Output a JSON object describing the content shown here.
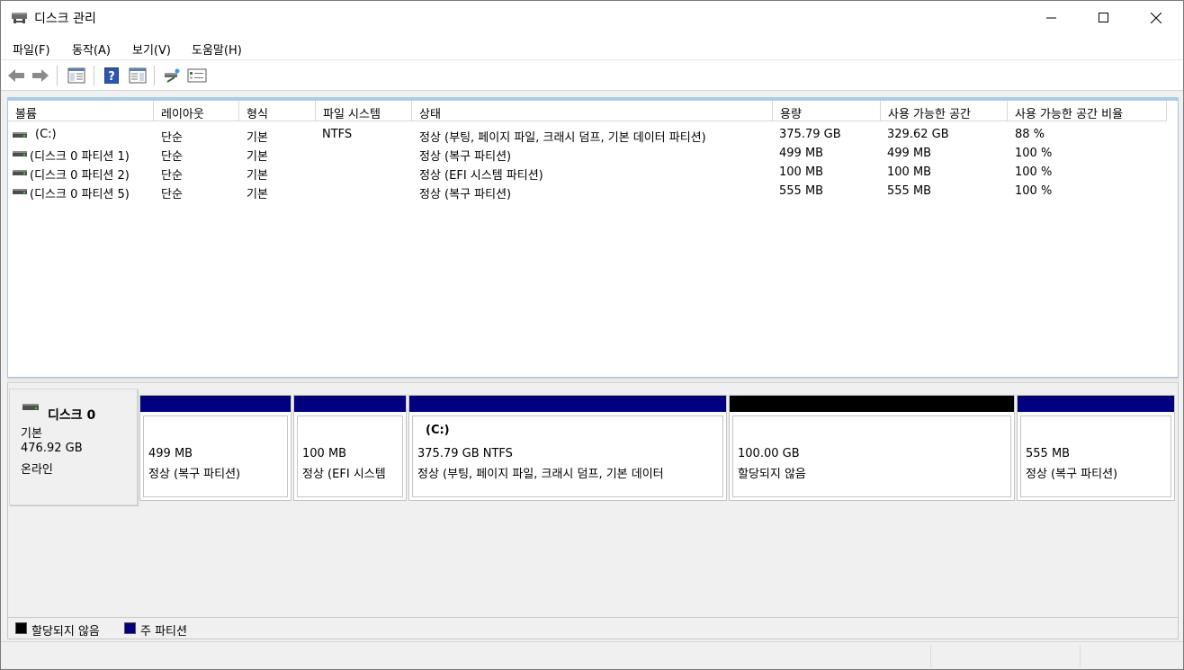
{
  "window": {
    "title": "디스크 관리",
    "controls": {
      "minimize": "minimize-icon",
      "maximize": "maximize-icon",
      "close": "close-icon"
    }
  },
  "menu": [
    "파일(F)",
    "동작(A)",
    "보기(V)",
    "도움말(H)"
  ],
  "toolbar": [
    "back-arrow-icon",
    "forward-arrow-icon",
    "show-hide-console-tree-icon",
    "help-icon",
    "show-hide-action-pane-icon",
    "connect-disk-icon",
    "properties-icon"
  ],
  "volume_list": {
    "columns": [
      "볼륨",
      "레이아웃",
      "형식",
      "파일 시스템",
      "상태",
      "용량",
      "사용 가능한 공간",
      "사용 가능한 공간 비율"
    ],
    "rows": [
      {
        "volume": "(C:)",
        "layout": "단순",
        "type": "기본",
        "fs": "NTFS",
        "status": "정상 (부팅, 페이지 파일, 크래시 덤프, 기본 데이터 파티션)",
        "capacity": "375.79 GB",
        "free": "329.62 GB",
        "pct": "88 %"
      },
      {
        "volume": "(디스크 0 파티션 1)",
        "layout": "단순",
        "type": "기본",
        "fs": "",
        "status": "정상 (복구 파티션)",
        "capacity": "499 MB",
        "free": "499 MB",
        "pct": "100 %"
      },
      {
        "volume": "(디스크 0 파티션 2)",
        "layout": "단순",
        "type": "기본",
        "fs": "",
        "status": "정상 (EFI 시스템 파티션)",
        "capacity": "100 MB",
        "free": "100 MB",
        "pct": "100 %"
      },
      {
        "volume": "(디스크 0 파티션 5)",
        "layout": "단순",
        "type": "기본",
        "fs": "",
        "status": "정상 (복구 파티션)",
        "capacity": "555 MB",
        "free": "555 MB",
        "pct": "100 %"
      }
    ]
  },
  "disk": {
    "name": "디스크 0",
    "type": "기본",
    "size": "476.92 GB",
    "status": "온라인",
    "partitions": [
      {
        "name": "",
        "size": "499 MB",
        "status": "정상 (복구 파티션)",
        "kind": "primary"
      },
      {
        "name": "",
        "size": "100 MB",
        "status": "정상 (EFI 시스템",
        "kind": "primary"
      },
      {
        "name": "(C:)",
        "size": "375.79 GB NTFS",
        "status": "정상 (부팅, 페이지 파일, 크래시 덤프, 기본 데이터",
        "kind": "primary"
      },
      {
        "name": "",
        "size": "100.00 GB",
        "status": "할당되지 않음",
        "kind": "unallocated"
      },
      {
        "name": "",
        "size": "555 MB",
        "status": "정상 (복구 파티션)",
        "kind": "primary"
      }
    ]
  },
  "legend": [
    {
      "label": "할당되지 않음",
      "color": "#000000"
    },
    {
      "label": "주 파티션",
      "color": "#000080"
    }
  ],
  "colors": {
    "primary": "#000080",
    "unallocated": "#000000",
    "header_accent": "#aacbef"
  }
}
